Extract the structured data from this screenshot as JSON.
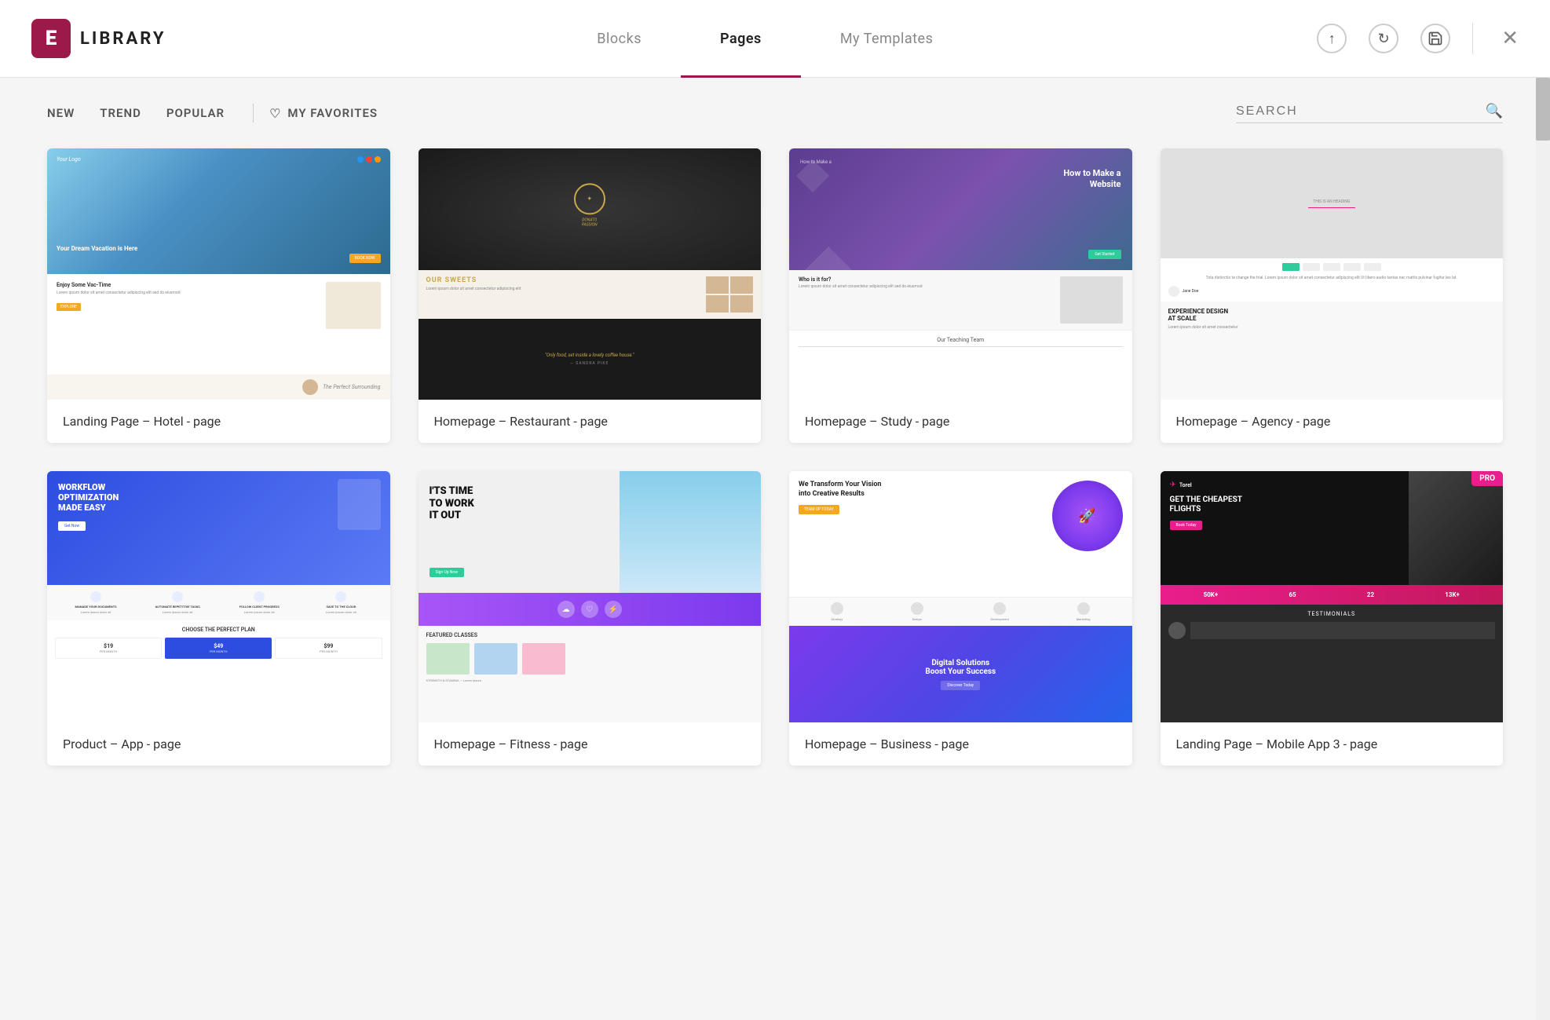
{
  "header": {
    "logo_icon": "E",
    "logo_text": "LIBRARY",
    "nav_tabs": [
      {
        "id": "blocks",
        "label": "Blocks",
        "active": false
      },
      {
        "id": "pages",
        "label": "Pages",
        "active": true
      },
      {
        "id": "my-templates",
        "label": "My Templates",
        "active": false
      }
    ],
    "icons": {
      "upload": "↑",
      "refresh": "↻",
      "save": "💾",
      "close": "✕"
    }
  },
  "filter_bar": {
    "filters": [
      {
        "id": "new",
        "label": "NEW"
      },
      {
        "id": "trend",
        "label": "TREND"
      },
      {
        "id": "popular",
        "label": "POPULAR"
      }
    ],
    "favorites_label": "MY FAVORITES",
    "search_placeholder": "SEARCH"
  },
  "cards": [
    {
      "id": "hotel",
      "label": "Landing Page – Hotel - page",
      "type": "hotel",
      "pro": false
    },
    {
      "id": "restaurant",
      "label": "Homepage – Restaurant - page",
      "type": "restaurant",
      "pro": false
    },
    {
      "id": "study",
      "label": "Homepage – Study - page",
      "type": "study",
      "pro": false
    },
    {
      "id": "agency",
      "label": "Homepage – Agency - page",
      "type": "agency",
      "pro": false
    },
    {
      "id": "product-app",
      "label": "Product – App - page",
      "type": "product",
      "pro": false,
      "hero_text": "WORKFLOW OPTIMIZATION MADE EASY"
    },
    {
      "id": "fitness",
      "label": "Homepage – Fitness - page",
      "type": "fitness",
      "pro": false,
      "hero_text": "I'TS TIME TO WORK IT OUT"
    },
    {
      "id": "business",
      "label": "Homepage – Business - page",
      "type": "business",
      "pro": false,
      "hero_text": "We Transform Your Vision into Creative Results"
    },
    {
      "id": "mobile-app",
      "label": "Landing Page – Mobile App 3 - page",
      "type": "mobile",
      "pro": true,
      "pro_label": "PRO"
    }
  ],
  "pricing": {
    "plans": [
      {
        "price": "$19",
        "label": "PER MONTH"
      },
      {
        "price": "$49",
        "label": "PER MONTH",
        "highlight": true
      },
      {
        "price": "$99",
        "label": "PER MONTH"
      }
    ]
  },
  "mobile_stats": [
    {
      "value": "50K+",
      "label": ""
    },
    {
      "value": "65",
      "label": ""
    },
    {
      "value": "22",
      "label": ""
    },
    {
      "value": "13K+",
      "label": ""
    }
  ],
  "colors": {
    "brand_red": "#9b1a4a",
    "active_tab_underline": "#9b1a4a",
    "pro_badge": "#e91e8c",
    "product_blue": "#2d4de0",
    "fitness_purple": "#a855f7",
    "study_hero": "#5c3d8f"
  }
}
